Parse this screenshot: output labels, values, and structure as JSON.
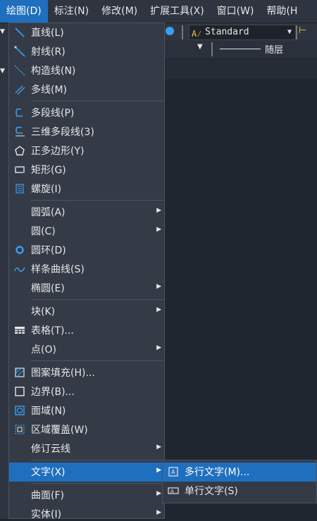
{
  "menubar": {
    "items": [
      "绘图(D)",
      "标注(N)",
      "修改(M)",
      "扩展工具(X)",
      "窗口(W)",
      "帮助(H"
    ]
  },
  "toolbar": {
    "text_style": "Standard",
    "layer_line_label": "随层"
  },
  "draw_menu": {
    "items": [
      {
        "label": "直线(L)",
        "icon": "line-icon"
      },
      {
        "label": "射线(R)",
        "icon": "ray-icon"
      },
      {
        "label": "构造线(N)",
        "icon": "construction-line-icon"
      },
      {
        "label": "多线(M)",
        "icon": "multiline-icon"
      },
      {
        "label": "多段线(P)",
        "icon": "polyline-icon"
      },
      {
        "label": "三维多段线(3)",
        "icon": "3d-polyline-icon"
      },
      {
        "label": "正多边形(Y)",
        "icon": "polygon-icon"
      },
      {
        "label": "矩形(G)",
        "icon": "rectangle-icon"
      },
      {
        "label": "螺旋(I)",
        "icon": "helix-icon"
      },
      {
        "label": "圆弧(A)",
        "submenu": true
      },
      {
        "label": "圆(C)",
        "submenu": true
      },
      {
        "label": "圆环(D)",
        "icon": "donut-icon"
      },
      {
        "label": "样条曲线(S)",
        "icon": "spline-icon"
      },
      {
        "label": "椭圆(E)",
        "submenu": true
      },
      {
        "label": "块(K)",
        "submenu": true
      },
      {
        "label": "表格(T)...",
        "icon": "table-icon"
      },
      {
        "label": "点(O)",
        "submenu": true
      },
      {
        "label": "图案填充(H)...",
        "icon": "hatch-icon"
      },
      {
        "label": "边界(B)...",
        "icon": "boundary-icon"
      },
      {
        "label": "面域(N)",
        "icon": "region-icon"
      },
      {
        "label": "区域覆盖(W)",
        "icon": "wipeout-icon"
      },
      {
        "label": "修订云线",
        "submenu": true
      },
      {
        "label": "文字(X)",
        "submenu": true
      },
      {
        "label": "曲面(F)",
        "submenu": true
      },
      {
        "label": "实体(I)",
        "submenu": true
      }
    ]
  },
  "text_submenu": {
    "items": [
      {
        "label": "多行文字(M)...",
        "icon": "mtext-icon"
      },
      {
        "label": "单行文字(S)",
        "icon": "single-line-text-icon"
      }
    ]
  },
  "colors": {
    "highlight": "#1f6fbf",
    "menu_bg": "#343b47",
    "icon_blue": "#3a9ff0"
  }
}
